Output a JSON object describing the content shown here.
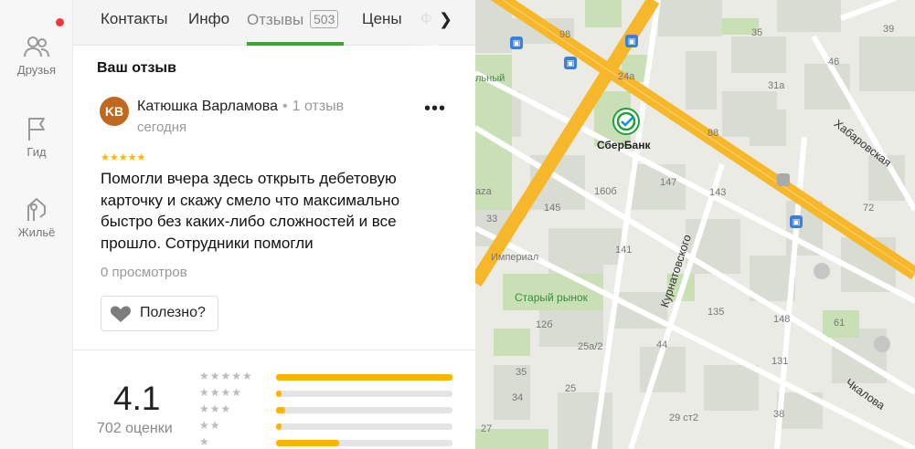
{
  "rail": {
    "items": [
      {
        "label": "Друзья",
        "icon": "friends-icon"
      },
      {
        "label": "Гид",
        "icon": "flag-icon"
      },
      {
        "label": "Жильё",
        "icon": "house-icon"
      }
    ]
  },
  "tabs": {
    "items": [
      "Контакты",
      "Инфо",
      "Отзывы",
      "Цены",
      "Ф"
    ],
    "reviews_count": "503",
    "active": "Отзывы"
  },
  "review": {
    "section_title": "Ваш отзыв",
    "avatar_initials": "KB",
    "author": "Катюшка Варламова",
    "author_reviews": "1 отзыв",
    "date": "сегодня",
    "stars": "★★★★★",
    "rating_value": 5,
    "text": "Помогли вчера здесь открыть дебетовую карточку и скажу смело что максимально быстро без каких-либо сложностей и все прошло. Сотрудники помогли",
    "views": "0 просмотров",
    "useful_label": "Полезно?",
    "more_label": "•••"
  },
  "summary": {
    "rating": "4.1",
    "count": "702 оценки",
    "distribution": [
      {
        "stars": "★★★★★",
        "fraction": 1.0
      },
      {
        "stars": "★★★★",
        "fraction": 0.03
      },
      {
        "stars": "★★★",
        "fraction": 0.05
      },
      {
        "stars": "★★",
        "fraction": 0.03
      },
      {
        "stars": "★",
        "fraction": 0.36
      }
    ]
  },
  "map": {
    "poi_name": "СберБанк",
    "park_name": "Старый рынок",
    "streets": [
      "Хабаровская",
      "Курнатовского",
      "Чкалова"
    ],
    "labels": [
      "98",
      "35",
      "46",
      "24а",
      "31а",
      "39",
      "88",
      "147",
      "143",
      "160б",
      "145",
      "72",
      "33",
      "141",
      "Империал",
      "135",
      "148",
      "61",
      "12б",
      "25а/2",
      "44",
      "131",
      "35",
      "25",
      "34",
      "29 ст2",
      "38",
      "льный",
      "aza",
      "27"
    ],
    "colors": {
      "road": "#f7b72a",
      "land": "#eaebe5",
      "block": "#d9dcd3",
      "park": "#c9dfb6",
      "sber": "#21a038"
    }
  }
}
